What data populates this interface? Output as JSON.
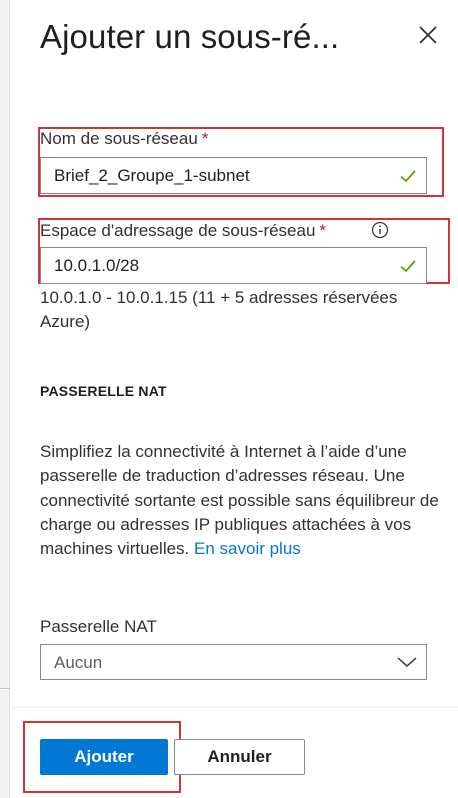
{
  "panel": {
    "title": "Ajouter un sous-ré...",
    "close_icon": "close-icon"
  },
  "subnet_name": {
    "label": "Nom de sous-réseau",
    "required_mark": "*",
    "value": "Brief_2_Groupe_1-subnet",
    "valid_icon": "check-icon"
  },
  "address_space": {
    "label": "Espace d'adressage de sous-réseau",
    "required_mark": "*",
    "info_icon": "info-icon",
    "value": "10.0.1.0/28",
    "valid_icon": "check-icon",
    "hint": "10.0.1.0 - 10.0.1.15 (11 + 5 adresses réservées Azure)"
  },
  "nat_gateway": {
    "section_heading": "PASSERELLE NAT",
    "description": "Simplifiez la connectivité à Internet à l’aide d’une passerelle de traduction d’adresses réseau. Une connectivité sortante est possible sans équilibreur de charge ou adresses IP publiques attachées à vos machines virtuelles.",
    "learn_more": "En savoir plus",
    "field_label": "Passerelle NAT",
    "selected": "Aucun"
  },
  "footer": {
    "add_label": "Ajouter",
    "cancel_label": "Annuler"
  },
  "colors": {
    "accent": "#0078d4",
    "required": "#a4262c",
    "valid": "#57a300",
    "highlight": "#d13438"
  }
}
